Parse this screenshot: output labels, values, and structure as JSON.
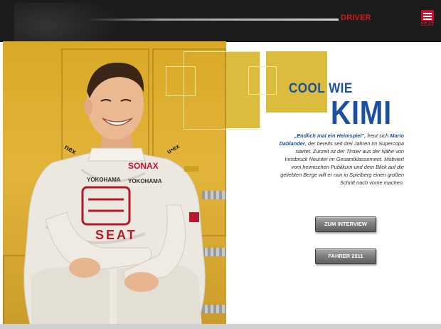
{
  "header": {
    "section_label": "DRIVER",
    "brand_name": "SEAT"
  },
  "article": {
    "headline_line1": "COOL WIE",
    "headline_line2": "KIMI",
    "body_quote": "„Endlich mal ein Heimspiel“,",
    "body_verb": " freut sich ",
    "body_name": "Mario Dablander",
    "body_rest": ", der bereits seit drei Jahren im Supercopa startet. Zurzeit ist der Tiroler aus der Nähe von Innsbruck Neunter im Gesamtklassement. Motiviert vom heimischen Publikum und dem Blick auf die geliebten Berge will er nun in Spielberg einen großen Schritt nach vorne machen."
  },
  "buttons": {
    "interview_label": "ZUM INTERVIEW",
    "season_label": "FAHRER 2011"
  },
  "suit": {
    "sponsor_1": "SONAX",
    "sponsor_2": "YOKOHAMA",
    "sponsor_3": "YOKOHAMA",
    "brand": "SEAT",
    "sleeve_left": "nex",
    "sleeve_right": "u•ex"
  },
  "colors": {
    "accent_blue": "#1a4fa1",
    "accent_red": "#d21a1a",
    "panel_yellow": "#dcbc3c",
    "header_dark": "#1c1c1c"
  }
}
